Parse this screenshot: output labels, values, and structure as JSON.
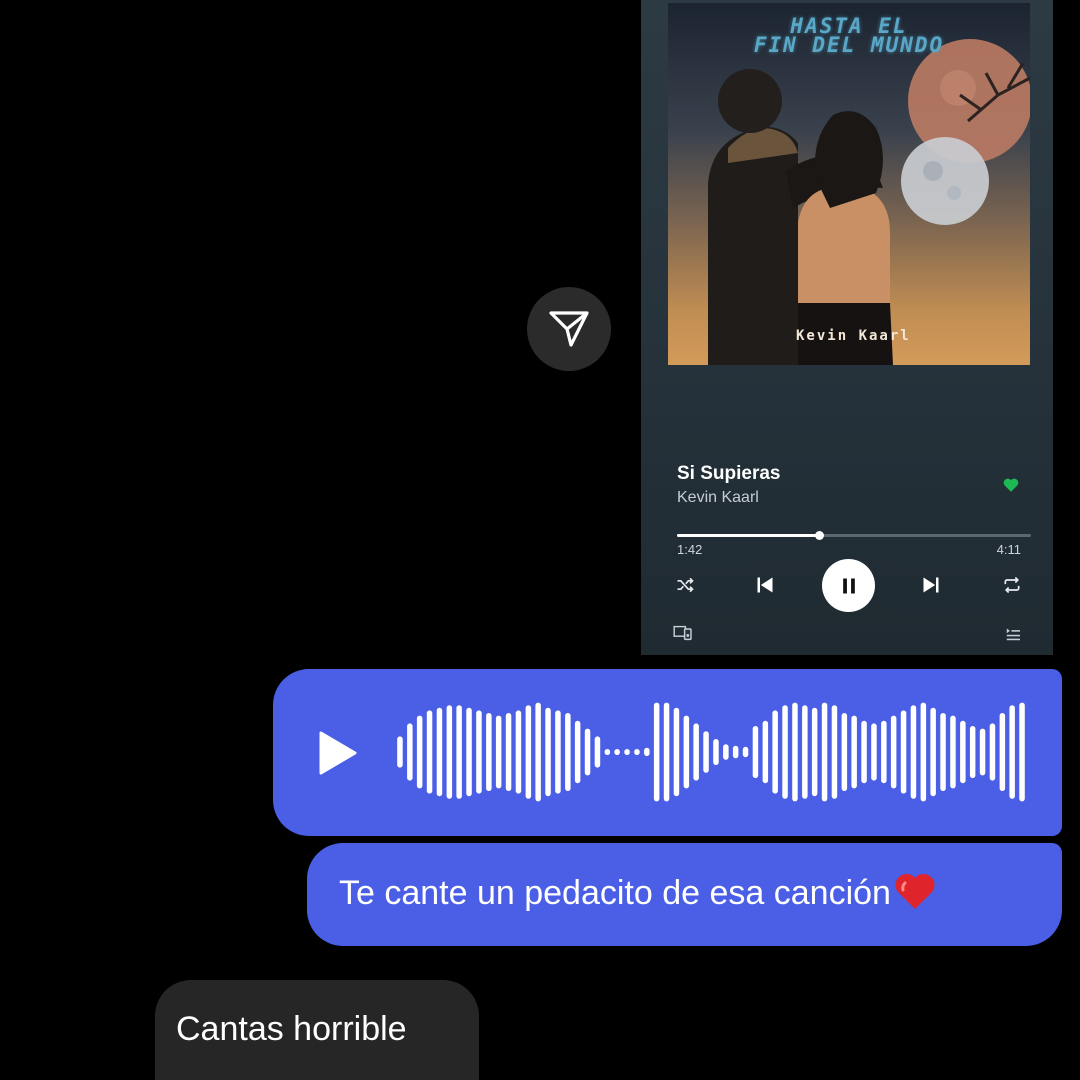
{
  "song_card": {
    "album_title_line1": "HASTA EL",
    "album_title_line2": "FIN DEL MUNDO",
    "album_artist": "Kevin Kaarl",
    "track_title": "Si Supieras",
    "track_artist": "Kevin Kaarl",
    "liked": true,
    "progress_fraction": 0.4,
    "time_elapsed": "1:42",
    "time_total": "4:11",
    "accent_color": "#1db954",
    "icons": [
      "shuffle-icon",
      "previous-icon",
      "pause-icon",
      "next-icon",
      "repeat-icon",
      "devices-icon",
      "queue-icon",
      "heart-icon"
    ]
  },
  "share": {
    "icon": "send-icon"
  },
  "voice_message": {
    "icon": "play-icon",
    "bubble_color": "#4a5fe6",
    "waveform_heights": [
      0.3,
      0.55,
      0.7,
      0.8,
      0.85,
      0.9,
      0.9,
      0.85,
      0.8,
      0.75,
      0.7,
      0.75,
      0.8,
      0.9,
      0.95,
      0.85,
      0.8,
      0.75,
      0.6,
      0.45,
      0.3,
      0.05,
      0.05,
      0.05,
      0.05,
      0.08,
      0.95,
      0.95,
      0.85,
      0.7,
      0.55,
      0.4,
      0.25,
      0.15,
      0.12,
      0.1,
      0.5,
      0.6,
      0.8,
      0.9,
      0.95,
      0.9,
      0.85,
      0.95,
      0.9,
      0.75,
      0.7,
      0.6,
      0.55,
      0.6,
      0.7,
      0.8,
      0.9,
      0.95,
      0.85,
      0.75,
      0.7,
      0.6,
      0.5,
      0.45,
      0.55,
      0.75,
      0.9,
      0.95
    ]
  },
  "messages": {
    "sent_text": "Te cante un pedacito de esa canción",
    "sent_emoji": "heart-emoji",
    "received_text": "Cantas horrible"
  }
}
